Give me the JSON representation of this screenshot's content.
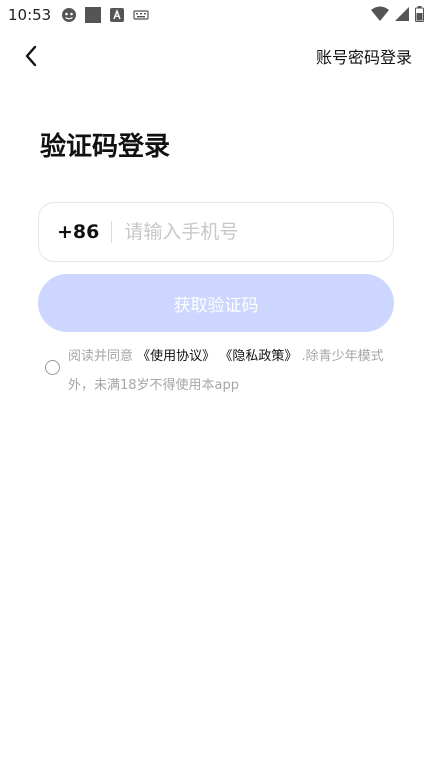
{
  "status_bar": {
    "time": "10:53",
    "icons_left": [
      "smiley-face-icon",
      "square-icon",
      "font-a-icon",
      "keyboard-icon"
    ],
    "icons_right": [
      "wifi-icon",
      "signal-icon",
      "battery-icon"
    ]
  },
  "nav": {
    "back_icon": "chevron-left-icon",
    "account_login_label": "账号密码登录"
  },
  "page": {
    "title": "验证码登录"
  },
  "phone": {
    "country_code": "+86",
    "placeholder": "请输入手机号",
    "value": ""
  },
  "get_code": {
    "label": "获取验证码",
    "bg_color": "#cdd6fe"
  },
  "agreement": {
    "prefix": "阅读并同意",
    "user_agreement": "《使用协议》",
    "privacy_policy": "《隐私政策》",
    "suffix": ".除青少年模式外，未满18岁不得使用本app",
    "checked": false
  }
}
